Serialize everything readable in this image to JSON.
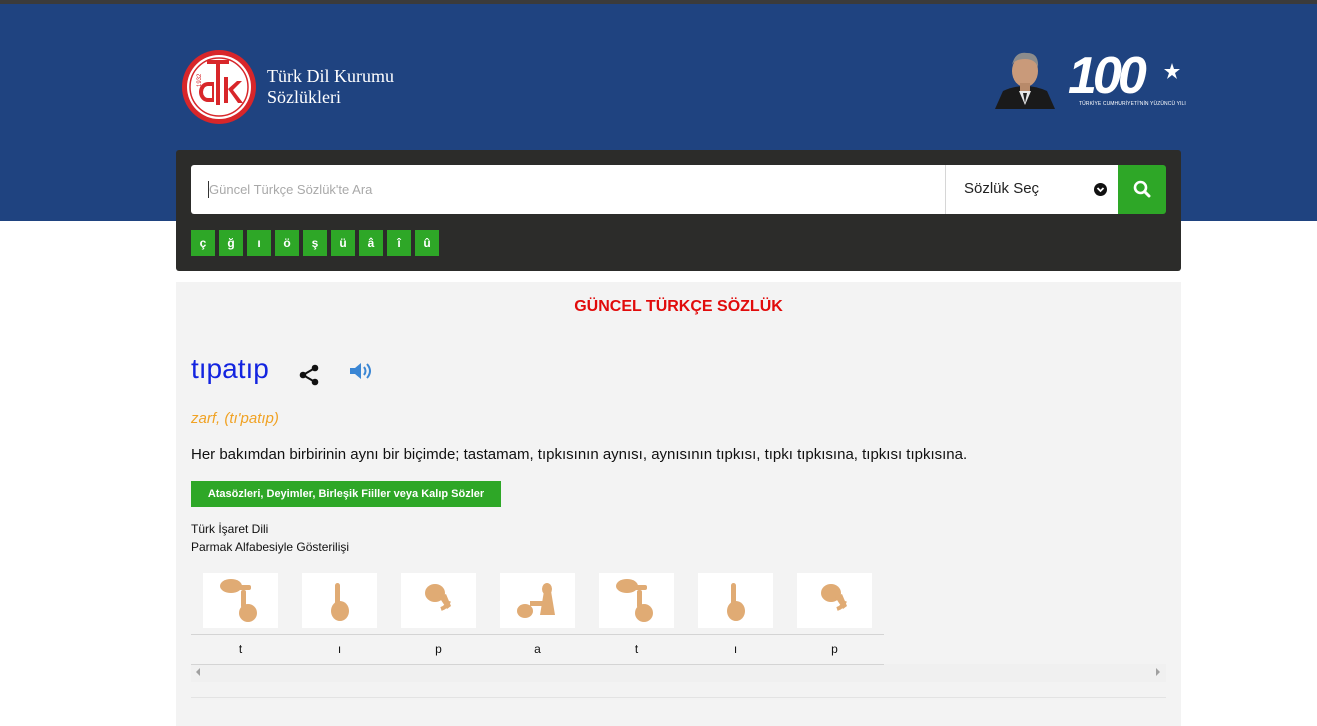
{
  "header": {
    "brand_line1": "Türk Dil Kurumu",
    "brand_line2": "Sözlükleri",
    "logo_year": "1932",
    "logo_letters": "TDK",
    "centennial_number": "100",
    "centennial_caption": "TÜRKİYE CUMHURİYETİ'NİN YÜZÜNCÜ YILI"
  },
  "search": {
    "placeholder": "Güncel Türkçe Sözlük'te Ara",
    "value": "",
    "dictionary_select_label": "Sözlük Seç",
    "search_icon": "search-icon"
  },
  "special_chars": [
    "ç",
    "ğ",
    "ı",
    "ö",
    "ş",
    "ü",
    "â",
    "î",
    "û"
  ],
  "content": {
    "dictionary_title": "GÜNCEL TÜRKÇE SÖZLÜK",
    "word": "tıpatıp",
    "part_of_speech": "zarf, (tı'patıp)",
    "meaning": "Her bakımdan birbirinin aynı bir biçimde; tastamam, tıpkısının aynısı, aynısının tıpkısı, tıpkı tıpkısına, tıpkısı tıpkısına.",
    "idioms_button": "Atasözleri, Deyimler, Birleşik Fiiller veya Kalıp Sözler",
    "sign_language_line1": "Türk İşaret Dili",
    "sign_language_line2": "Parmak Alfabesiyle Gösterilişi",
    "fingerspelling_letters": [
      "t",
      "ı",
      "p",
      "a",
      "t",
      "ı",
      "p"
    ]
  },
  "colors": {
    "header_bg": "#1f4380",
    "search_panel_bg": "#2c2c2a",
    "accent_green": "#2ea727",
    "title_red": "#e10b0b",
    "word_blue": "#1324e0",
    "pos_orange": "#f0a224",
    "content_bg": "#f3f3f3",
    "skin_tone": "#e0ab74"
  }
}
